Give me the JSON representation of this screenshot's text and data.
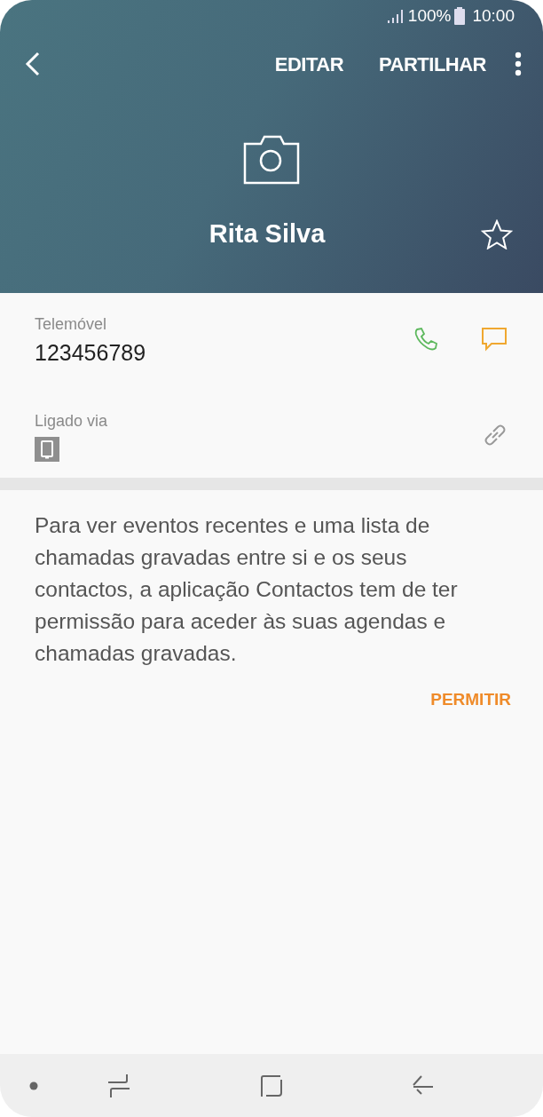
{
  "status_bar": {
    "battery": "100%",
    "time": "10:00"
  },
  "toolbar": {
    "actions": [
      "EDITAR",
      "PARTILHAR"
    ]
  },
  "contact": {
    "name": "Rita Silva",
    "favorite": false
  },
  "phone": {
    "label": "Telemóvel",
    "number": "123456789"
  },
  "linked": {
    "label": "Ligado via"
  },
  "permission": {
    "text": "Para ver eventos recentes e uma lista de chamadas gravadas entre si e os seus contactos, a aplicação Contactos tem de ter permissão para aceder às suas agendas e chamadas gravadas.",
    "button": "PERMITIR"
  }
}
